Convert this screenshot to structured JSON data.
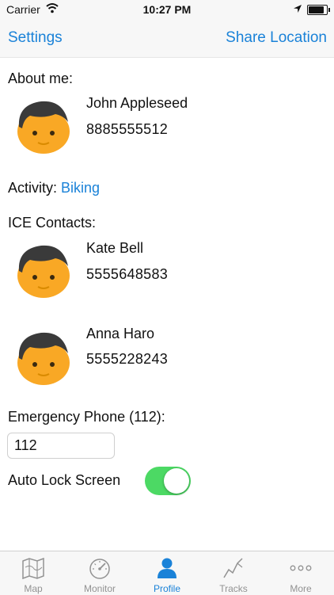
{
  "status_bar": {
    "carrier": "Carrier",
    "time": "10:27 PM",
    "battery_level": 0.95
  },
  "nav": {
    "left_label": "Settings",
    "right_label": "Share Location"
  },
  "about": {
    "label": "About me:",
    "name": "John Appleseed",
    "phone": "8885555512"
  },
  "activity": {
    "label": "Activity:",
    "value": "Biking"
  },
  "ice": {
    "label": "ICE Contacts:",
    "contacts": [
      {
        "name": "Kate Bell",
        "phone": "5555648583"
      },
      {
        "name": "Anna Haro",
        "phone": "5555228243"
      }
    ]
  },
  "emergency": {
    "label": "Emergency Phone (112):",
    "value": "112"
  },
  "auto_lock": {
    "label": "Auto Lock Screen",
    "enabled": true
  },
  "tabs": [
    {
      "label": "Map",
      "icon": "map-icon"
    },
    {
      "label": "Monitor",
      "icon": "speedometer-icon"
    },
    {
      "label": "Profile",
      "icon": "person-icon",
      "active": true
    },
    {
      "label": "Tracks",
      "icon": "tracks-icon"
    },
    {
      "label": "More",
      "icon": "more-icon"
    }
  ],
  "colors": {
    "accent": "#1a82d8",
    "toggle_on": "#4cd964",
    "avatar_face": "#f9a825",
    "avatar_hair": "#3a3a3a"
  }
}
